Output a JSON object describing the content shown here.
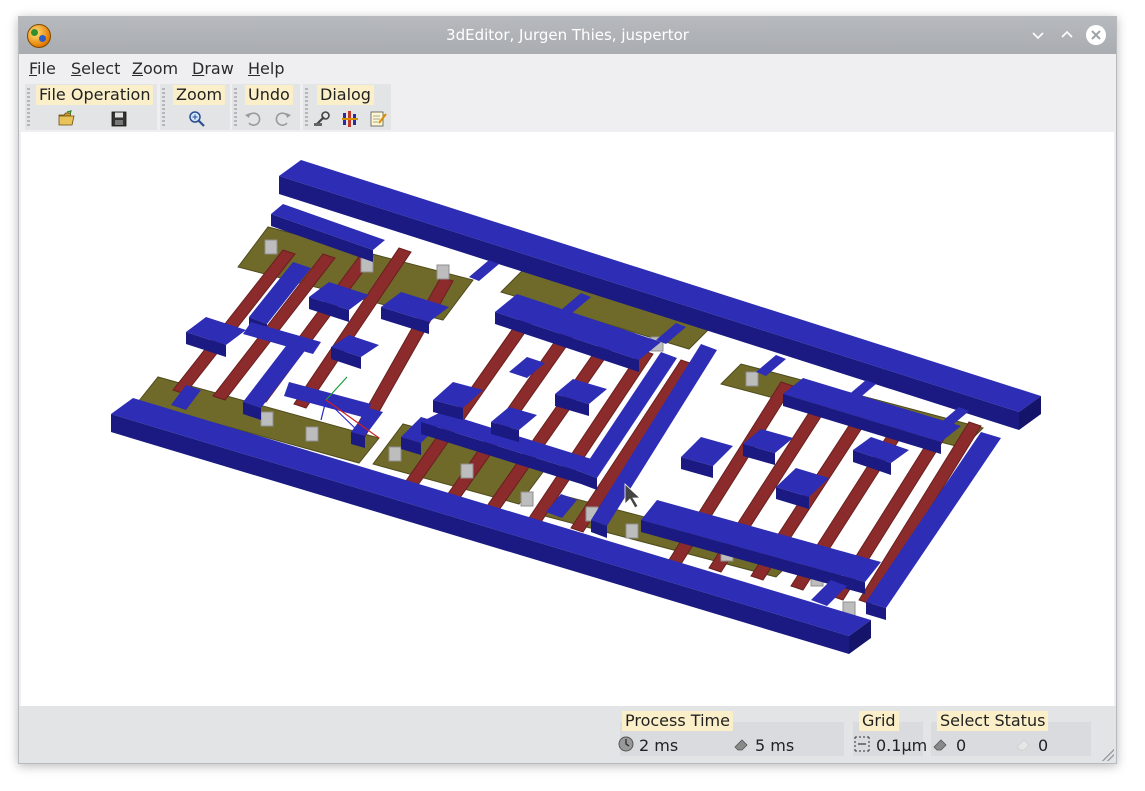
{
  "window": {
    "title": "3dEditor, Jurgen Thies, juspertor"
  },
  "menu": {
    "items": [
      {
        "accel": "F",
        "rest": "ile"
      },
      {
        "accel": "S",
        "rest": "elect"
      },
      {
        "accel": "Z",
        "rest": "oom"
      },
      {
        "accel": "D",
        "rest": "raw"
      },
      {
        "accel": "H",
        "rest": "elp"
      }
    ]
  },
  "toolbar": {
    "file_operation": {
      "label": "File Operation",
      "icons": [
        "open-folder-icon",
        "save-disk-icon"
      ]
    },
    "zoom": {
      "label": "Zoom",
      "icons": [
        "zoom-magnifier-icon"
      ]
    },
    "undo": {
      "label": "Undo",
      "icons": [
        "undo-icon",
        "redo-icon"
      ]
    },
    "dialog": {
      "label": "Dialog",
      "icons": [
        "wrench-settings-icon",
        "layers-dialog-icon",
        "edit-note-icon"
      ]
    }
  },
  "status": {
    "process_time": {
      "label": "Process Time",
      "value1": "2 ms",
      "value2": "5 ms"
    },
    "grid": {
      "label": "Grid",
      "value": "0.1µm"
    },
    "select_status": {
      "label": "Select Status",
      "value1": "0",
      "value2": "0"
    }
  },
  "colors": {
    "metal": "#2a2aa3",
    "poly": "#8c2b2b",
    "diffusion": "#6f6a2a",
    "via": "#b9b9b9",
    "title_bar": "#aeb1b5",
    "label_bg": "#fbefc9"
  }
}
